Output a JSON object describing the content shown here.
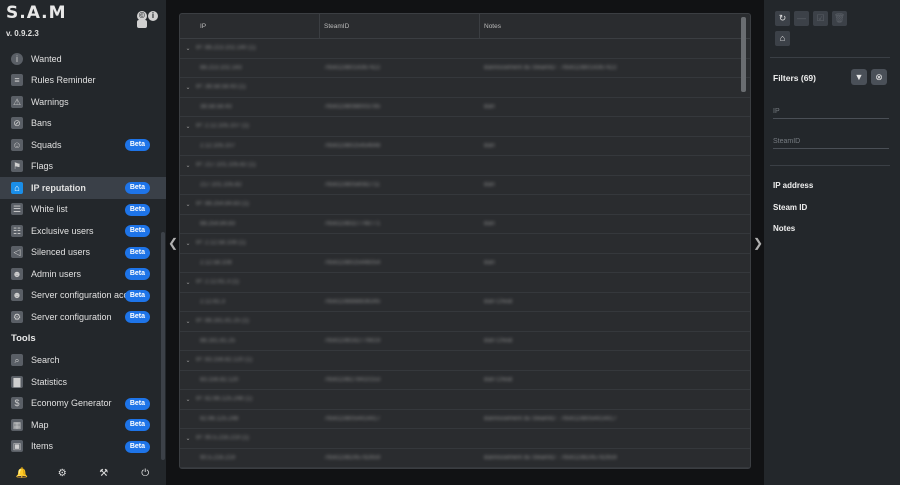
{
  "app": {
    "logo": "S.A.M",
    "version": "v. 0.9.2.3"
  },
  "header_icons": [
    "copyright-icon",
    "info-icon",
    "message-icon"
  ],
  "nav": [
    {
      "label": "Wanted",
      "icon": "info-icon",
      "beta": "",
      "active": false
    },
    {
      "label": "Rules Reminder",
      "icon": "document-icon",
      "beta": "",
      "active": false
    },
    {
      "label": "Warnings",
      "icon": "warning-icon",
      "beta": "",
      "active": false
    },
    {
      "label": "Bans",
      "icon": "ban-icon",
      "beta": "",
      "active": false
    },
    {
      "label": "Squads",
      "icon": "group-icon",
      "beta": "Beta",
      "active": false
    },
    {
      "label": "Flags",
      "icon": "flag-icon",
      "beta": "",
      "active": false
    },
    {
      "label": "IP reputation",
      "icon": "ip-icon",
      "beta": "Beta",
      "active": true
    },
    {
      "label": "White list",
      "icon": "list-icon",
      "beta": "Beta",
      "active": false
    },
    {
      "label": "Exclusive users",
      "icon": "clipboard-icon",
      "beta": "Beta",
      "active": false
    },
    {
      "label": "Silenced users",
      "icon": "mute-icon",
      "beta": "Beta",
      "active": false
    },
    {
      "label": "Admin users",
      "icon": "admin-icon",
      "beta": "Beta",
      "active": false
    },
    {
      "label": "Server configuration access",
      "icon": "user-key-icon",
      "beta": "Beta",
      "active": false
    },
    {
      "label": "Server configuration",
      "icon": "gears-icon",
      "beta": "Beta",
      "active": false
    }
  ],
  "tools_title": "Tools",
  "tools": [
    {
      "label": "Search",
      "icon": "search-icon",
      "beta": ""
    },
    {
      "label": "Statistics",
      "icon": "chart-icon",
      "beta": ""
    },
    {
      "label": "Economy Generator",
      "icon": "money-icon",
      "beta": "Beta"
    },
    {
      "label": "Map",
      "icon": "map-icon",
      "beta": "Beta"
    },
    {
      "label": "Items",
      "icon": "box-icon",
      "beta": "Beta"
    }
  ],
  "footer_icons": [
    "bell-icon",
    "gear-icon",
    "tools-icon",
    "power-icon"
  ],
  "table": {
    "columns": [
      "IP",
      "SteamID",
      "Notes"
    ],
    "groups": [
      {
        "label": "IP: 88.213.102.140 (1)",
        "ip": "88.213.102.143",
        "steamid": "76561198014367422",
        "notes": "Bannissement du SteamID : 76561198014367422"
      },
      {
        "label": "IP: 38.58.58.43 (1)",
        "ip": "38.58.58.43",
        "steamid": "76561198088003785",
        "notes": "Ban"
      },
      {
        "label": "IP: 2.12.105.107 (1)",
        "ip": "2.12.105.107",
        "steamid": "76561198025454648",
        "notes": "Ban"
      },
      {
        "label": "IP: 217.101.105.82 (1)",
        "ip": "217.101.105.82",
        "steamid": "76561198058082711",
        "notes": "Ban"
      },
      {
        "label": "IP: 88.254.84.83 (1)",
        "ip": "88.254.84.83",
        "steamid": "76561198327748771",
        "notes": "Ban"
      },
      {
        "label": "IP: 2.12.58.108 (1)",
        "ip": "2.12.58.108",
        "steamid": "76561198025446054",
        "notes": "Ban"
      },
      {
        "label": "IP: 2.12.61.3 (1)",
        "ip": "2.12.61.3",
        "steamid": "76561198888836345",
        "notes": "Ban Cheat"
      },
      {
        "label": "IP: 88.161.81.25 (1)",
        "ip": "88.161.81.25",
        "steamid": "76561198162776619",
        "notes": "Ban Cheat"
      },
      {
        "label": "IP: 83.156.82.120 (1)",
        "ip": "83.156.82.120",
        "steamid": "76561198278410153",
        "notes": "Ban Cheat"
      },
      {
        "label": "IP: 82.66.125.248 (1)",
        "ip": "82.66.125.248",
        "steamid": "76561198054414417",
        "notes": "Bannissement du SteamID : 76561198054414417"
      },
      {
        "label": "IP: 90.5.216.219 (1)",
        "ip": "90.5.216.219",
        "steamid": "76561198245782659",
        "notes": "Bannissement du SteamID : 76561198245782659"
      }
    ]
  },
  "right_panel": {
    "tool_icons": [
      "refresh-icon",
      "minus-icon",
      "checkbox-icon",
      "trash-icon",
      "ip-icon"
    ],
    "filters_title": "Filters (69)",
    "filter_icon": "filter-icon",
    "clear_icon": "clear-filter-icon",
    "ip_placeholder": "IP",
    "steamid_placeholder": "SteamID",
    "columns": [
      "IP address",
      "Steam ID",
      "Notes"
    ]
  }
}
